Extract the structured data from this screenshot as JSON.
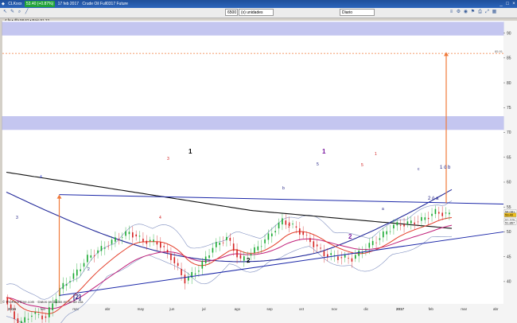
{
  "window": {
    "title": "Crude Oil Full0317 Future",
    "symbol": "CLKxxx",
    "change": "53.40 (+0.87%)",
    "date": "17 feb 2017",
    "controls": [
      "_",
      "□",
      "×"
    ]
  },
  "toolbar": {
    "units_value": "6500",
    "units_label": "(x) unidades",
    "period": "Diario"
  },
  "info_line": "4 fe • dfa 58.62 • Bajo 51.22",
  "credit": "© ProRealTime.com · Datos recibidos en fin de día",
  "colors": {
    "band": "#5a5fd6",
    "trendline": "#1b27a8",
    "arrow": "#f07a3a",
    "sma200": "#111111",
    "sma100": "#232a9a",
    "ema_red": "#e4402c",
    "ema_pink": "#c0207a",
    "bollinger": "#7f8fc0",
    "bull": "#16a82e",
    "bear": "#d42020"
  },
  "chart_data": {
    "type": "candlestick",
    "y_ticks": [
      40,
      45,
      50,
      55,
      60,
      65,
      70,
      75,
      80,
      85,
      90
    ],
    "ylim": [
      35.5,
      92.5
    ],
    "x_ticks": [
      "2016",
      "feb",
      "mar",
      "abr",
      "may",
      "jun",
      "jul",
      "ago",
      "sep",
      "oct",
      "nov",
      "dic",
      "2017",
      "feb",
      "mar",
      "abr"
    ],
    "price_labels": [
      "54.081",
      "53.40",
      "52.375",
      "51.867"
    ],
    "target_label": "85.91",
    "close": [
      36.8,
      31.2,
      33.5,
      32.8,
      38.5,
      41.2,
      44.8,
      46.6,
      48.5,
      49.9,
      48.2,
      47.9,
      44.9,
      40.2,
      42.6,
      46.9,
      48.8,
      44.2,
      46.3,
      49.1,
      52.3,
      50.7,
      48.1,
      45.5,
      44.9,
      44.6,
      46.8,
      48.9,
      51.3,
      51.7,
      52.4,
      54.0,
      53.4
    ],
    "labels": [
      {
        "text": "1",
        "color": "black",
        "bold": true
      },
      {
        "text": "1",
        "color": "purple",
        "bold": true
      },
      {
        "text": "2",
        "color": "black",
        "bold": true
      },
      {
        "text": "2",
        "color": "purple",
        "bold": true
      },
      {
        "text": "[2]",
        "color": "navy",
        "bold": true
      },
      {
        "text": "1 ó b",
        "color": "navy",
        "bold": false
      },
      {
        "text": "2 ó a",
        "color": "navy",
        "bold": false
      },
      {
        "text": "2",
        "color": "navy",
        "bold": false
      },
      {
        "text": "3",
        "color": "navy",
        "bold": false
      },
      {
        "text": "4",
        "color": "blue",
        "bold": false
      },
      {
        "text": "5",
        "color": "navy",
        "bold": false
      },
      {
        "text": "a",
        "color": "navy",
        "bold": false
      },
      {
        "text": "b",
        "color": "navy",
        "bold": false
      },
      {
        "text": "c",
        "color": "navy",
        "bold": false
      },
      {
        "text": "1",
        "color": "red",
        "bold": false
      },
      {
        "text": "2",
        "color": "red",
        "bold": false
      },
      {
        "text": "3",
        "color": "red",
        "bold": false
      },
      {
        "text": "4",
        "color": "red",
        "bold": false
      },
      {
        "text": "5",
        "color": "red",
        "bold": false
      }
    ]
  }
}
